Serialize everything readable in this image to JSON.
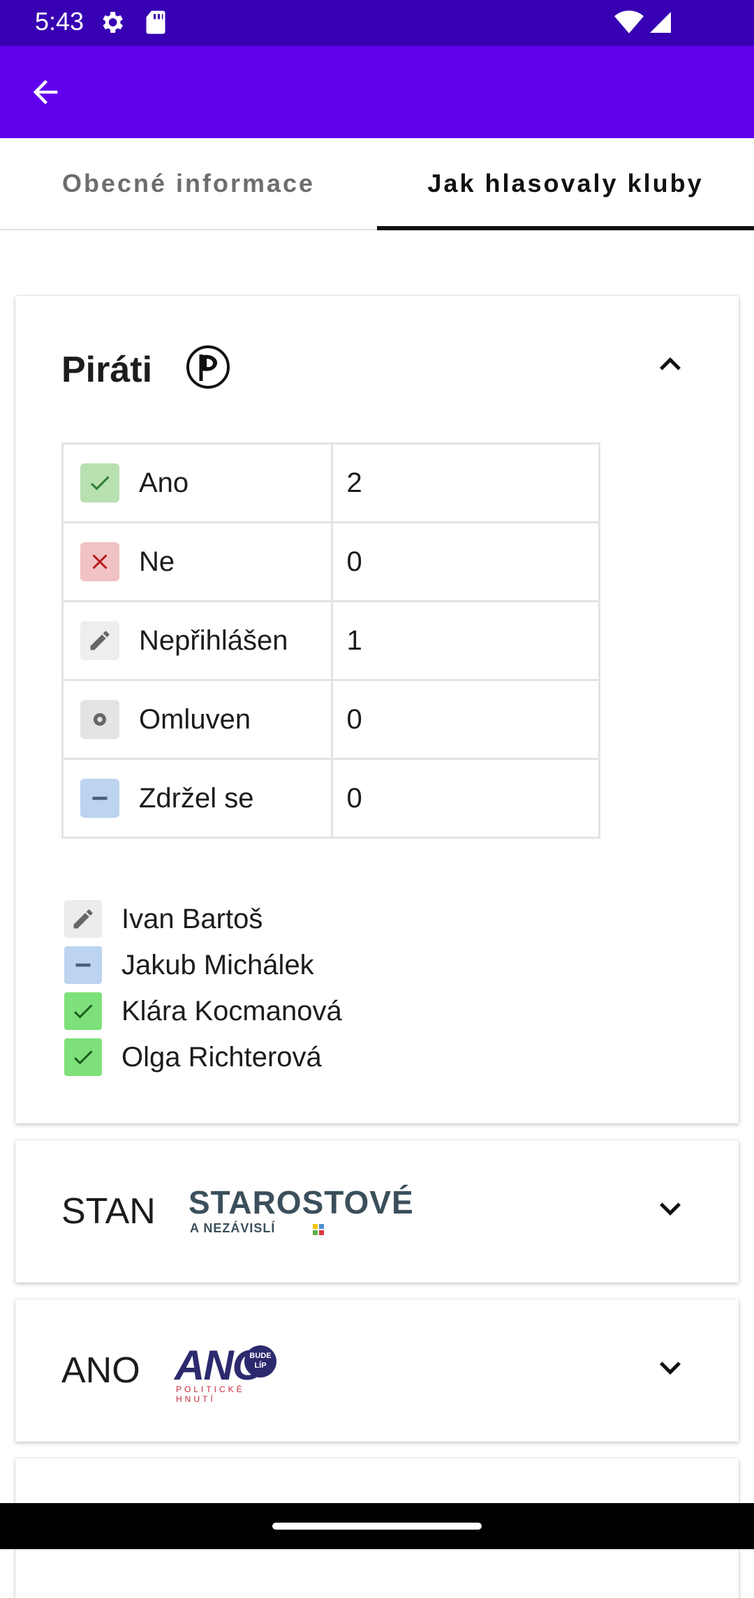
{
  "status_bar": {
    "time": "5:43"
  },
  "tabs": [
    {
      "label": "Obecné informace",
      "selected": false
    },
    {
      "label": "Jak hlasovaly kluby",
      "selected": true
    }
  ],
  "clubs": [
    {
      "name": "Piráti",
      "expanded": true,
      "votes": [
        {
          "label": "Ano",
          "count": "2",
          "icon": "check-icon"
        },
        {
          "label": "Ne",
          "count": "0",
          "icon": "cross-icon"
        },
        {
          "label": "Nepřihlášen",
          "count": "1",
          "icon": "pencil-icon"
        },
        {
          "label": "Omluven",
          "count": "0",
          "icon": "dot-icon"
        },
        {
          "label": "Zdržel se",
          "count": "0",
          "icon": "minus-icon"
        }
      ],
      "members": [
        {
          "name": "Ivan Bartoš",
          "vote": "Nepřihlášen"
        },
        {
          "name": "Jakub Michálek",
          "vote": "Zdržel se"
        },
        {
          "name": "Klára Kocmanová",
          "vote": "Ano"
        },
        {
          "name": "Olga Richterová",
          "vote": "Ano"
        }
      ]
    },
    {
      "name": "STAN",
      "expanded": false,
      "logo_text": "STAROSTOVÉ",
      "logo_subtext": "A NEZÁVISLÍ"
    },
    {
      "name": "ANO",
      "expanded": false,
      "logo_text": "ANO",
      "logo_badge": "BUDE LÍP",
      "logo_subtext": "POLITICKÉ HNUTÍ"
    }
  ],
  "colors": {
    "status_bar": "#3700b3",
    "app_bar": "#6200ee",
    "yes": "#7ee07a",
    "no": "#f0c2c4",
    "abstain": "#bcd4ef"
  }
}
